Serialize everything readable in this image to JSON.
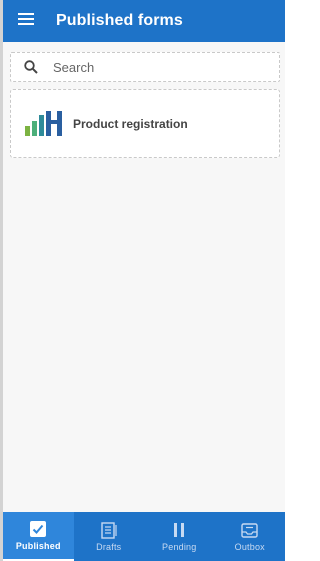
{
  "header": {
    "title": "Published forms",
    "menu_icon": "hamburger-menu-icon"
  },
  "search": {
    "placeholder": "Search",
    "value": "",
    "icon": "search-icon"
  },
  "forms": [
    {
      "name": "Product registration",
      "icon": "bar-chart-logo-icon"
    }
  ],
  "bottom_nav": {
    "items": [
      {
        "label": "Published",
        "icon": "checkbox-icon",
        "active": true
      },
      {
        "label": "Drafts",
        "icon": "document-icon",
        "active": false
      },
      {
        "label": "Pending",
        "icon": "pause-icon",
        "active": false
      },
      {
        "label": "Outbox",
        "icon": "inbox-tray-icon",
        "active": false
      }
    ]
  },
  "colors": {
    "primary": "#1e73c8",
    "active_tab": "#2f86db",
    "logo_green": "#7cb342",
    "logo_teal": "#2e8b99",
    "logo_blue": "#2a5fa0"
  }
}
